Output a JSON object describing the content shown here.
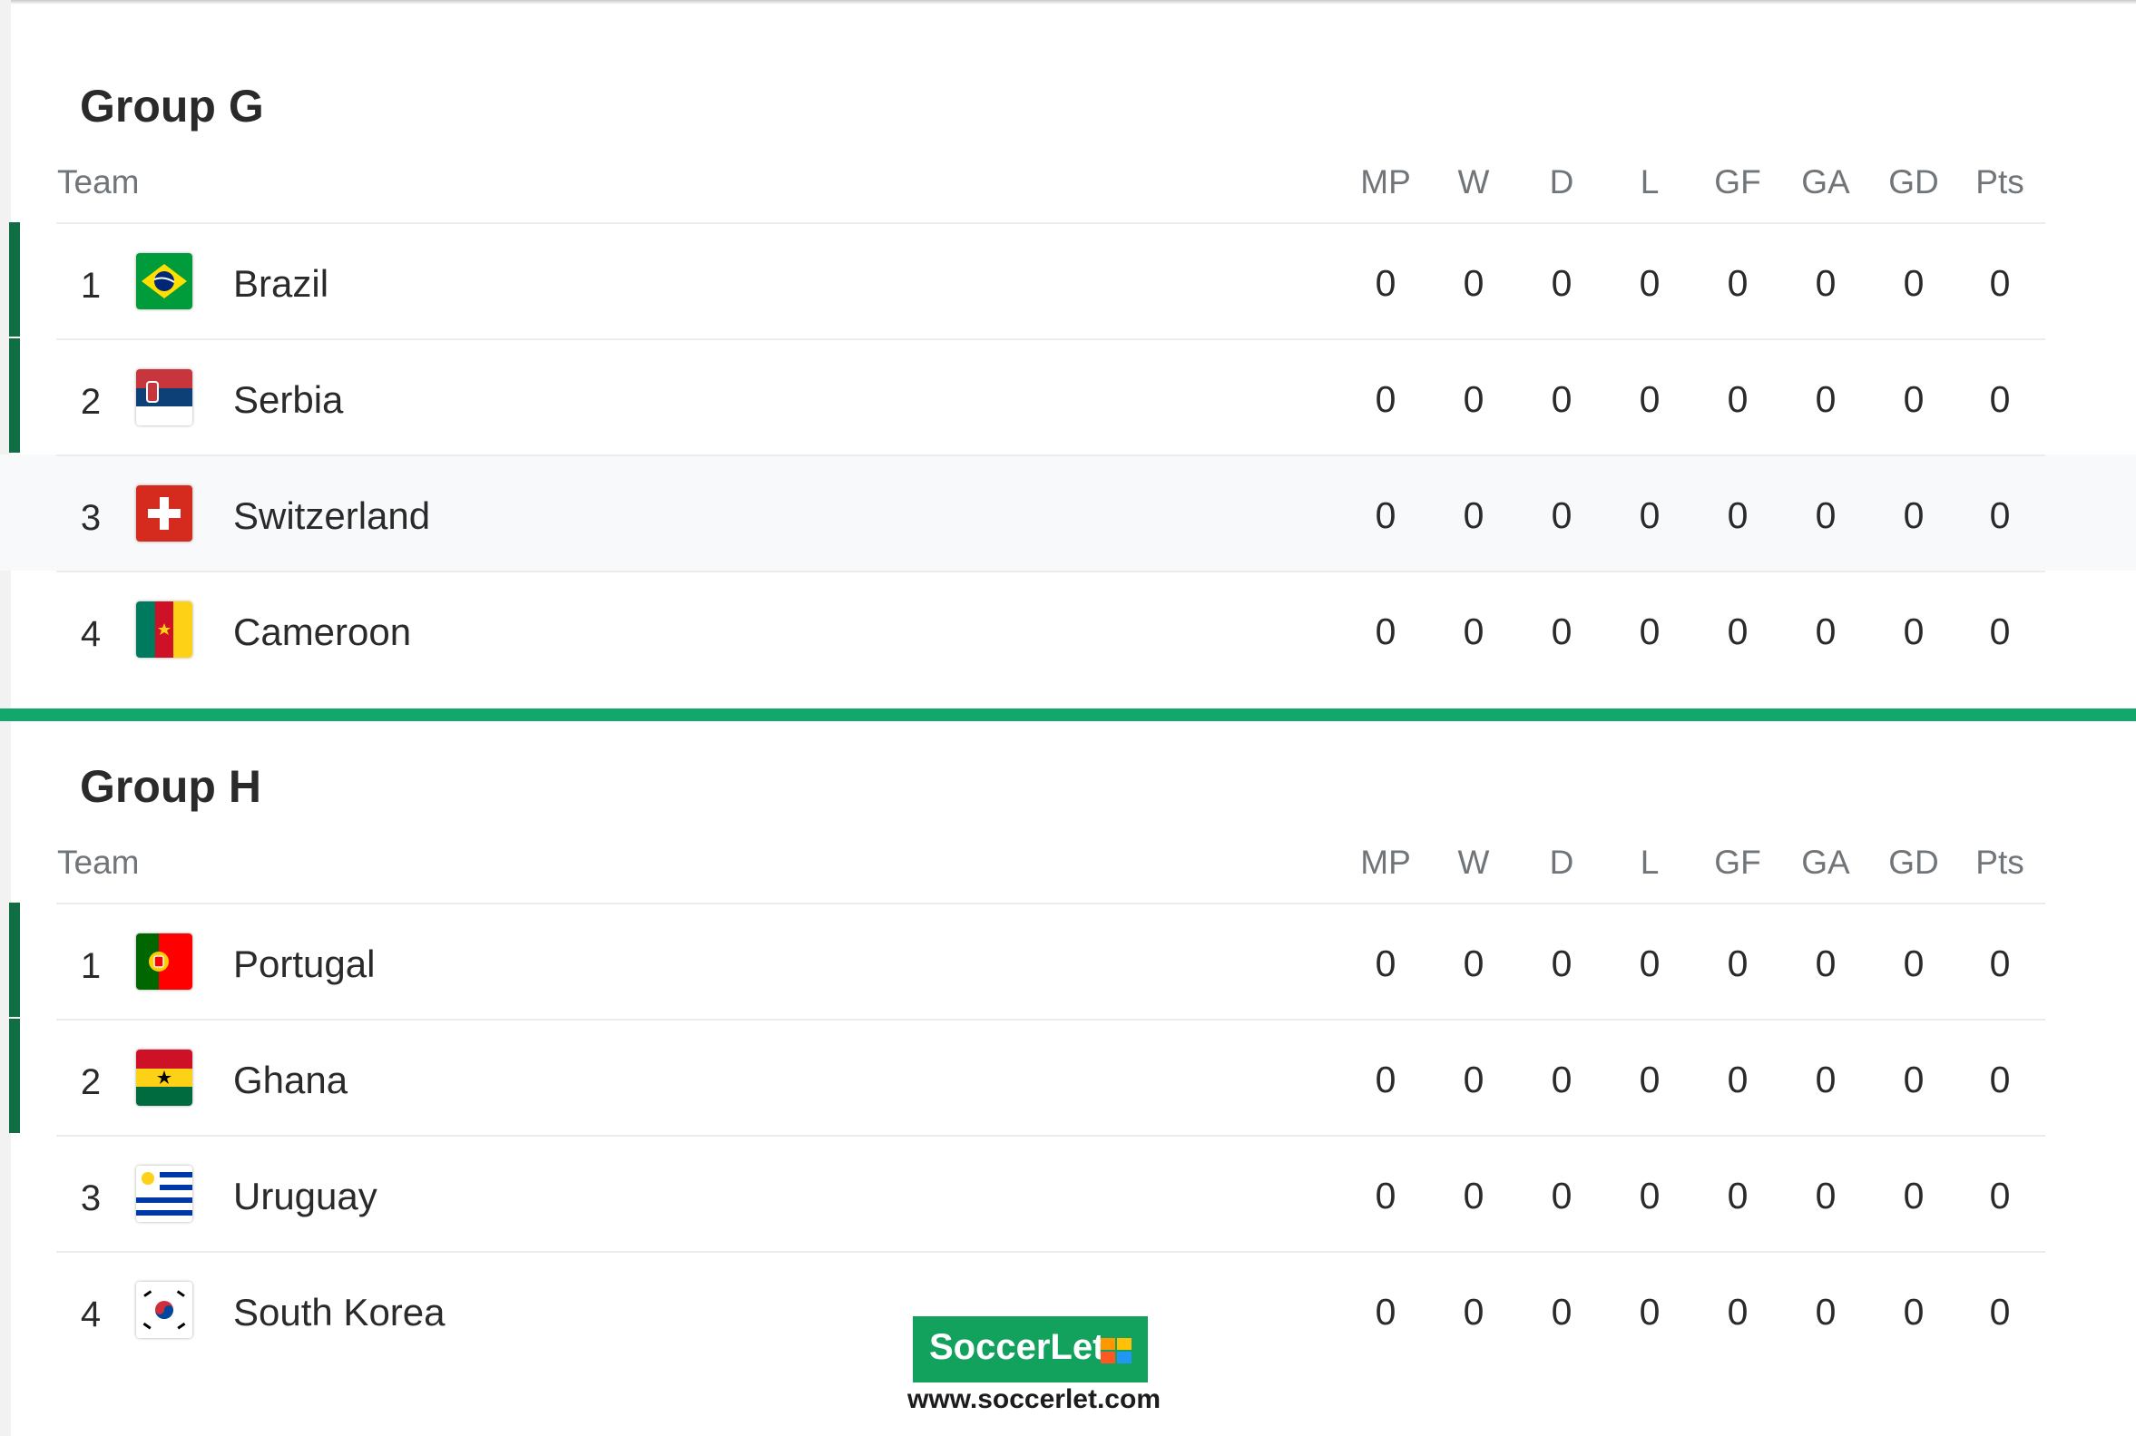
{
  "columns": {
    "team": "Team",
    "stats": [
      "MP",
      "W",
      "D",
      "L",
      "GF",
      "GA",
      "GD",
      "Pts"
    ]
  },
  "groups": [
    {
      "title": "Group G",
      "teams": [
        {
          "pos": "1",
          "name": "Brazil",
          "flag": "brazil-flag-icon",
          "stats": [
            "0",
            "0",
            "0",
            "0",
            "0",
            "0",
            "0",
            "0"
          ],
          "qualifying": true
        },
        {
          "pos": "2",
          "name": "Serbia",
          "flag": "serbia-flag-icon",
          "stats": [
            "0",
            "0",
            "0",
            "0",
            "0",
            "0",
            "0",
            "0"
          ],
          "qualifying": true
        },
        {
          "pos": "3",
          "name": "Switzerland",
          "flag": "switzerland-flag-icon",
          "stats": [
            "0",
            "0",
            "0",
            "0",
            "0",
            "0",
            "0",
            "0"
          ],
          "qualifying": false
        },
        {
          "pos": "4",
          "name": "Cameroon",
          "flag": "cameroon-flag-icon",
          "stats": [
            "0",
            "0",
            "0",
            "0",
            "0",
            "0",
            "0",
            "0"
          ],
          "qualifying": false
        }
      ]
    },
    {
      "title": "Group H",
      "teams": [
        {
          "pos": "1",
          "name": "Portugal",
          "flag": "portugal-flag-icon",
          "stats": [
            "0",
            "0",
            "0",
            "0",
            "0",
            "0",
            "0",
            "0"
          ],
          "qualifying": true
        },
        {
          "pos": "2",
          "name": "Ghana",
          "flag": "ghana-flag-icon",
          "stats": [
            "0",
            "0",
            "0",
            "0",
            "0",
            "0",
            "0",
            "0"
          ],
          "qualifying": true
        },
        {
          "pos": "3",
          "name": "Uruguay",
          "flag": "uruguay-flag-icon",
          "stats": [
            "0",
            "0",
            "0",
            "0",
            "0",
            "0",
            "0",
            "0"
          ],
          "qualifying": false
        },
        {
          "pos": "4",
          "name": "South Korea",
          "flag": "south-korea-flag-icon",
          "stats": [
            "0",
            "0",
            "0",
            "0",
            "0",
            "0",
            "0",
            "0"
          ],
          "qualifying": false
        }
      ]
    }
  ],
  "colors": {
    "qualifying_bar": "#0f6e44",
    "divider": "#13a86b",
    "watermark_bg": "#13a25e"
  },
  "watermark": {
    "logo_text": "SoccerLet",
    "url": "www.soccerlet.com"
  }
}
